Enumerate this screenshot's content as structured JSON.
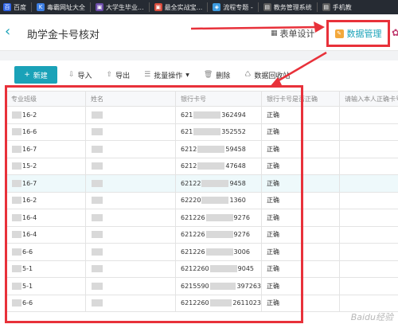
{
  "bookmarks": [
    {
      "label": "百度",
      "icon": "bookmark-baidu-icon",
      "color": "#2e63e6",
      "glyph": "百"
    },
    {
      "label": "毒霸网址大全",
      "icon": "bookmark-duba-icon",
      "color": "#3c7ee3",
      "glyph": "K"
    },
    {
      "label": "大学生毕业...",
      "icon": "bookmark-folder-icon",
      "color": "#6b4ba8",
      "glyph": "▣"
    },
    {
      "label": "最全实战宝...",
      "icon": "bookmark-folder-icon",
      "color": "#d84b3b",
      "glyph": "▣"
    },
    {
      "label": "流程专题 -",
      "icon": "bookmark-page-icon",
      "color": "#3c9be0",
      "glyph": "◈"
    },
    {
      "label": "教务管理系统",
      "icon": "bookmark-page-icon",
      "color": "#5a5a5a",
      "glyph": "▤"
    },
    {
      "label": "手机教",
      "icon": "bookmark-page-icon",
      "color": "#5a5a5a",
      "glyph": "▤"
    }
  ],
  "header": {
    "title": "助学金卡号核对",
    "tab_form": "表单设计",
    "tab_data": "数据管理"
  },
  "toolbar": {
    "new": "新建",
    "import": "导入",
    "export": "导出",
    "batch": "批量操作",
    "delete": "删除",
    "recycle": "数据回收站"
  },
  "table": {
    "columns": [
      "专业班级",
      "姓名",
      "银行卡号",
      "银行卡号是否正确",
      "请输入本人正确卡号"
    ],
    "rows": [
      {
        "class": "16-2",
        "card_prefix": "621",
        "card_suffix": "362494",
        "status": "正确"
      },
      {
        "class": "16-6",
        "card_prefix": "621",
        "card_suffix": "352552",
        "status": "正确"
      },
      {
        "class": "16-7",
        "card_prefix": "6212",
        "card_suffix": "59458",
        "status": "正确"
      },
      {
        "class": "15-2",
        "card_prefix": "6212",
        "card_suffix": "47648",
        "status": "正确"
      },
      {
        "class": "16-7",
        "card_prefix": "62122",
        "card_suffix": "9458",
        "status": "正确"
      },
      {
        "class": "16-2",
        "card_prefix": "62220",
        "card_suffix": "1360",
        "status": "正确"
      },
      {
        "class": "16-4",
        "card_prefix": "621226",
        "card_suffix": "9276",
        "status": "正确"
      },
      {
        "class": "16-4",
        "card_prefix": "621226",
        "card_suffix": "9276",
        "status": "正确"
      },
      {
        "class": "6-6",
        "card_prefix": "621226",
        "card_suffix": "3006",
        "status": "正确"
      },
      {
        "class": "5-1",
        "card_prefix": "6212260",
        "card_suffix": "9045",
        "status": "正确"
      },
      {
        "class": "5-1",
        "card_prefix": "6215590",
        "card_suffix": "397263",
        "status": "正确"
      },
      {
        "class": "6-6",
        "card_prefix": "6212260",
        "card_suffix": "2611023",
        "status": "正确"
      }
    ]
  },
  "watermark": "Baidu经验",
  "colors": {
    "accent": "#1aa2b8",
    "annotation": "#e8313a"
  }
}
